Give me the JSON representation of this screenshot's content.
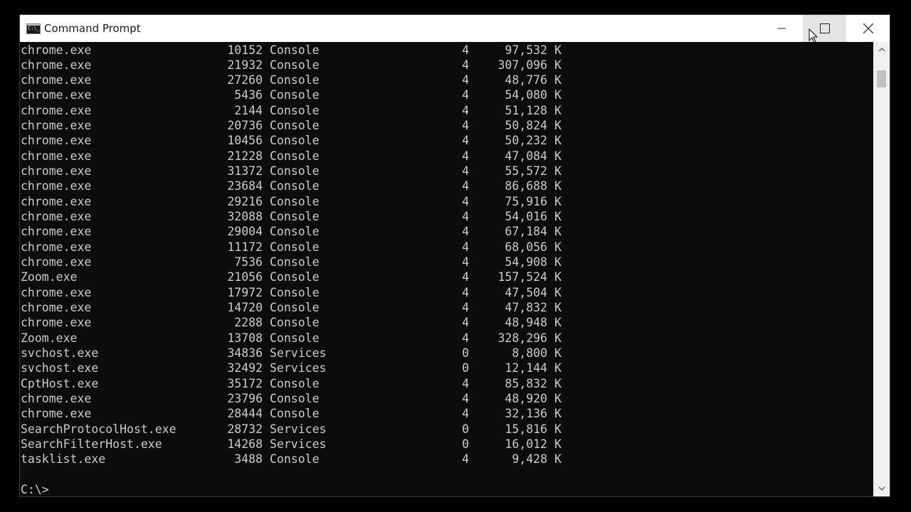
{
  "window": {
    "title": "Command Prompt",
    "colors": {
      "console_bg": "#0c0c0c",
      "console_fg": "#cccccc",
      "titlebar_bg": "#ffffff"
    }
  },
  "titlebar": {
    "app_icon": "cmd-icon",
    "buttons": [
      {
        "name": "minimize",
        "icon": "minimize-icon"
      },
      {
        "name": "maximize",
        "icon": "maximize-icon"
      },
      {
        "name": "close",
        "icon": "close-icon"
      }
    ]
  },
  "console": {
    "rows": [
      {
        "name": "chrome.exe",
        "pid": "10152",
        "session": "Console",
        "num": "4",
        "mem": "97,532",
        "unit": "K"
      },
      {
        "name": "chrome.exe",
        "pid": "21932",
        "session": "Console",
        "num": "4",
        "mem": "307,096",
        "unit": "K"
      },
      {
        "name": "chrome.exe",
        "pid": "27260",
        "session": "Console",
        "num": "4",
        "mem": "48,776",
        "unit": "K"
      },
      {
        "name": "chrome.exe",
        "pid": "5436",
        "session": "Console",
        "num": "4",
        "mem": "54,080",
        "unit": "K"
      },
      {
        "name": "chrome.exe",
        "pid": "2144",
        "session": "Console",
        "num": "4",
        "mem": "51,128",
        "unit": "K"
      },
      {
        "name": "chrome.exe",
        "pid": "20736",
        "session": "Console",
        "num": "4",
        "mem": "50,824",
        "unit": "K"
      },
      {
        "name": "chrome.exe",
        "pid": "10456",
        "session": "Console",
        "num": "4",
        "mem": "50,232",
        "unit": "K"
      },
      {
        "name": "chrome.exe",
        "pid": "21228",
        "session": "Console",
        "num": "4",
        "mem": "47,084",
        "unit": "K"
      },
      {
        "name": "chrome.exe",
        "pid": "31372",
        "session": "Console",
        "num": "4",
        "mem": "55,572",
        "unit": "K"
      },
      {
        "name": "chrome.exe",
        "pid": "23684",
        "session": "Console",
        "num": "4",
        "mem": "86,688",
        "unit": "K"
      },
      {
        "name": "chrome.exe",
        "pid": "29216",
        "session": "Console",
        "num": "4",
        "mem": "75,916",
        "unit": "K"
      },
      {
        "name": "chrome.exe",
        "pid": "32088",
        "session": "Console",
        "num": "4",
        "mem": "54,016",
        "unit": "K"
      },
      {
        "name": "chrome.exe",
        "pid": "29004",
        "session": "Console",
        "num": "4",
        "mem": "67,184",
        "unit": "K"
      },
      {
        "name": "chrome.exe",
        "pid": "11172",
        "session": "Console",
        "num": "4",
        "mem": "68,056",
        "unit": "K"
      },
      {
        "name": "chrome.exe",
        "pid": "7536",
        "session": "Console",
        "num": "4",
        "mem": "54,908",
        "unit": "K"
      },
      {
        "name": "Zoom.exe",
        "pid": "21056",
        "session": "Console",
        "num": "4",
        "mem": "157,524",
        "unit": "K"
      },
      {
        "name": "chrome.exe",
        "pid": "17972",
        "session": "Console",
        "num": "4",
        "mem": "47,504",
        "unit": "K"
      },
      {
        "name": "chrome.exe",
        "pid": "14720",
        "session": "Console",
        "num": "4",
        "mem": "47,832",
        "unit": "K"
      },
      {
        "name": "chrome.exe",
        "pid": "2288",
        "session": "Console",
        "num": "4",
        "mem": "48,948",
        "unit": "K"
      },
      {
        "name": "Zoom.exe",
        "pid": "13708",
        "session": "Console",
        "num": "4",
        "mem": "328,296",
        "unit": "K"
      },
      {
        "name": "svchost.exe",
        "pid": "34836",
        "session": "Services",
        "num": "0",
        "mem": "8,800",
        "unit": "K"
      },
      {
        "name": "svchost.exe",
        "pid": "32492",
        "session": "Services",
        "num": "0",
        "mem": "12,144",
        "unit": "K"
      },
      {
        "name": "CptHost.exe",
        "pid": "35172",
        "session": "Console",
        "num": "4",
        "mem": "85,832",
        "unit": "K"
      },
      {
        "name": "chrome.exe",
        "pid": "23796",
        "session": "Console",
        "num": "4",
        "mem": "48,920",
        "unit": "K"
      },
      {
        "name": "chrome.exe",
        "pid": "28444",
        "session": "Console",
        "num": "4",
        "mem": "32,136",
        "unit": "K"
      },
      {
        "name": "SearchProtocolHost.exe",
        "pid": "28732",
        "session": "Services",
        "num": "0",
        "mem": "15,816",
        "unit": "K"
      },
      {
        "name": "SearchFilterHost.exe",
        "pid": "14268",
        "session": "Services",
        "num": "0",
        "mem": "16,012",
        "unit": "K"
      },
      {
        "name": "tasklist.exe",
        "pid": "3488",
        "session": "Console",
        "num": "4",
        "mem": "9,428",
        "unit": "K"
      }
    ],
    "prompt": "C:\\>"
  },
  "scrollbar": {
    "up_icon": "chevron-up-icon",
    "down_icon": "chevron-down-icon"
  }
}
